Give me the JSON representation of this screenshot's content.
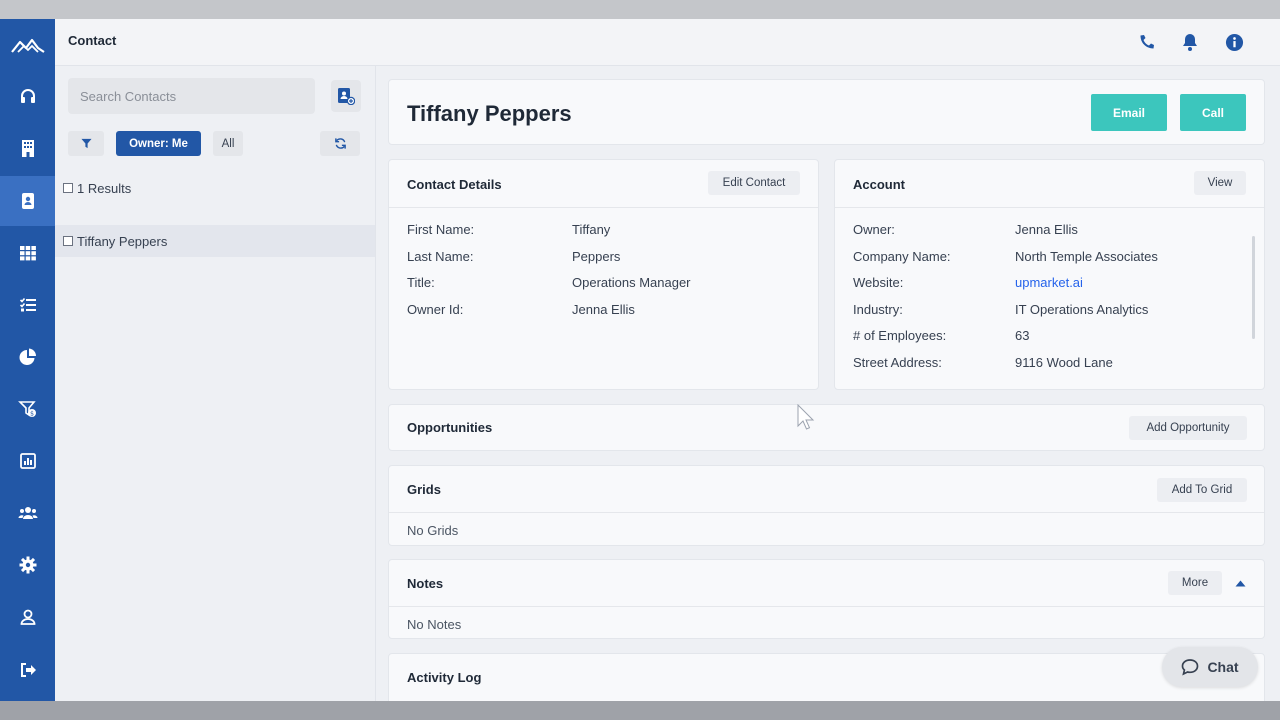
{
  "app": {
    "section_title": "Contact"
  },
  "sidebar": {
    "items": [
      {
        "icon": "headset-icon",
        "name": "sidebar-item-support"
      },
      {
        "icon": "building-icon",
        "name": "sidebar-item-accounts"
      },
      {
        "icon": "contact-card-icon",
        "name": "sidebar-item-contacts",
        "active": true
      },
      {
        "icon": "grid-icon",
        "name": "sidebar-item-grids"
      },
      {
        "icon": "checklist-icon",
        "name": "sidebar-item-tasks"
      },
      {
        "icon": "pie-chart-icon",
        "name": "sidebar-item-reports"
      },
      {
        "icon": "funnel-dollar-icon",
        "name": "sidebar-item-opportunities"
      },
      {
        "icon": "dashboard-icon",
        "name": "sidebar-item-dashboard"
      },
      {
        "icon": "users-icon",
        "name": "sidebar-item-users"
      },
      {
        "icon": "gear-icon",
        "name": "sidebar-item-settings"
      },
      {
        "icon": "user-icon",
        "name": "sidebar-item-profile"
      },
      {
        "icon": "sign-out-icon",
        "name": "sidebar-item-logout"
      }
    ]
  },
  "list": {
    "search_placeholder": "Search Contacts",
    "owner_filter_label": "Owner: Me",
    "all_label": "All",
    "results_label": "1 Results",
    "contacts": [
      "Tiffany Peppers"
    ]
  },
  "contact": {
    "name": "Tiffany Peppers",
    "email_label": "Email",
    "call_label": "Call"
  },
  "contact_details": {
    "title": "Contact Details",
    "edit_label": "Edit Contact",
    "fields": [
      {
        "label": "First Name:",
        "value": "Tiffany"
      },
      {
        "label": "Last Name:",
        "value": "Peppers"
      },
      {
        "label": "Title:",
        "value": "Operations Manager"
      },
      {
        "label": "Owner Id:",
        "value": "Jenna Ellis"
      }
    ]
  },
  "account": {
    "title": "Account",
    "view_label": "View",
    "fields": [
      {
        "label": "Owner:",
        "value": "Jenna Ellis"
      },
      {
        "label": "Company Name:",
        "value": "North Temple Associates"
      },
      {
        "label": "Website:",
        "value": "upmarket.ai"
      },
      {
        "label": "Industry:",
        "value": "IT Operations Analytics"
      },
      {
        "label": "# of Employees:",
        "value": "63"
      },
      {
        "label": "Street Address:",
        "value": "9116 Wood Lane"
      }
    ]
  },
  "opportunities": {
    "title": "Opportunities",
    "add_label": "Add Opportunity"
  },
  "grids": {
    "title": "Grids",
    "add_label": "Add To Grid",
    "empty_text": "No Grids"
  },
  "notes": {
    "title": "Notes",
    "more_label": "More",
    "empty_text": "No Notes"
  },
  "activity": {
    "title": "Activity Log"
  },
  "chat": {
    "label": "Chat"
  },
  "colors": {
    "primary": "#2257a6",
    "accent": "#3cc6bd",
    "link": "#2563eb"
  }
}
